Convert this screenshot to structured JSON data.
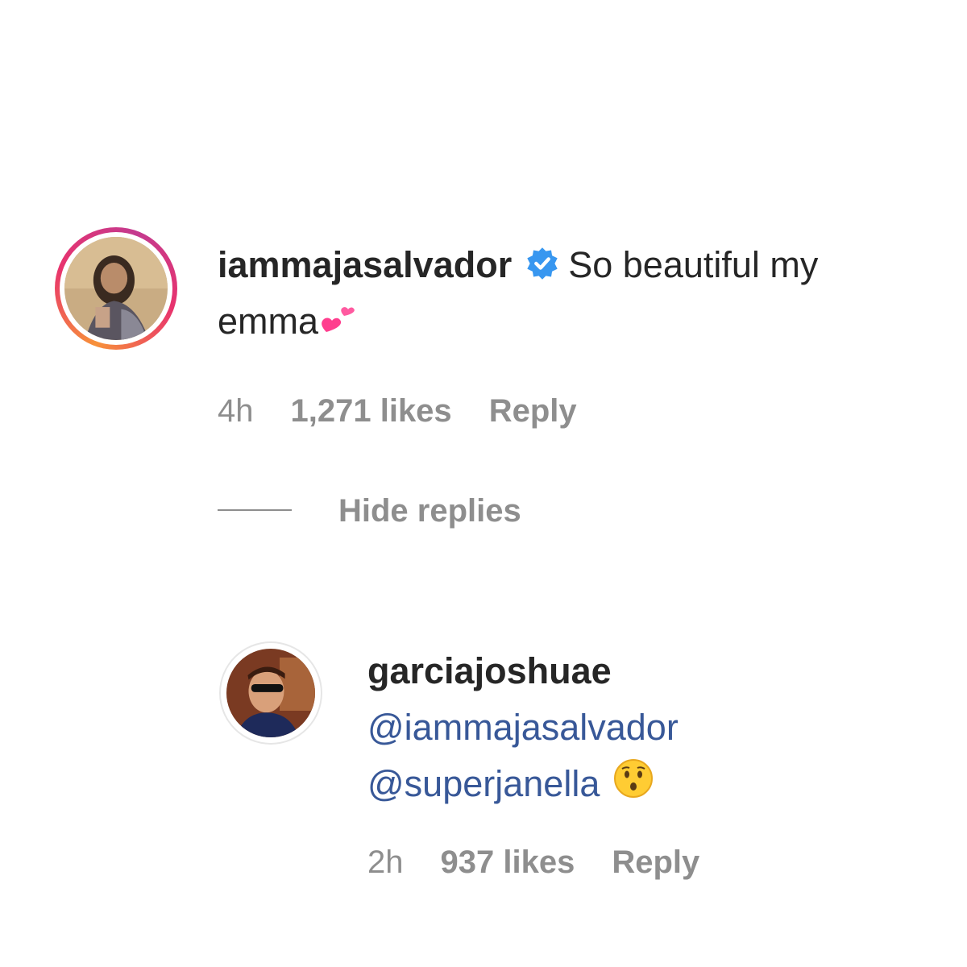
{
  "comment": {
    "username": "iammajasalvador",
    "verified_icon": "verified-badge-icon",
    "text": "So beautiful my emma",
    "emoji": "two-hearts-emoji",
    "time": "4h",
    "likes": "1,271 likes",
    "reply_label": "Reply",
    "avatar_ring": "story-ring"
  },
  "hide_replies_label": "Hide replies",
  "reply": {
    "username": "garciajoshuae",
    "mentions": [
      "@iammajasalvador",
      "@superjanella"
    ],
    "emoji": "hushed-face-emoji",
    "time": "2h",
    "likes": "937 likes",
    "reply_label": "Reply"
  },
  "colors": {
    "text": "#262626",
    "meta": "#8e8e8e",
    "mention": "#385898",
    "verified": "#3897f0",
    "heart": "#ff3e8e"
  }
}
